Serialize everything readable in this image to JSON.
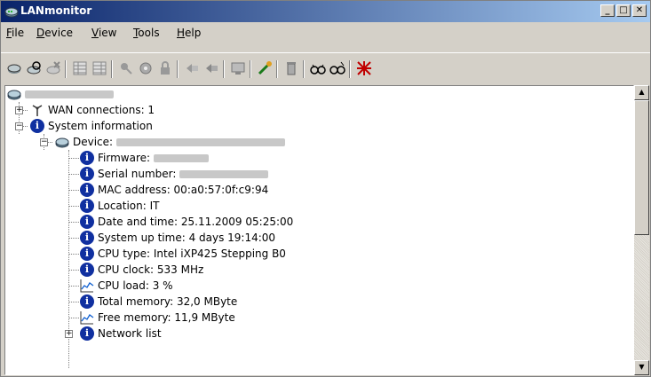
{
  "window": {
    "title": "LANmonitor",
    "controls": {
      "minimize": "_",
      "maximize": "□",
      "close": "✕"
    }
  },
  "menu": [
    {
      "label": "File",
      "u": "F",
      "rest": "ile"
    },
    {
      "label": "Device",
      "u": "D",
      "rest": "evice"
    },
    {
      "label": "View",
      "u": "V",
      "rest": "iew"
    },
    {
      "label": "Tools",
      "u": "T",
      "rest": "ools"
    },
    {
      "label": "Help",
      "u": "H",
      "rest": "elp"
    }
  ],
  "toolbar": {
    "icons": [
      "router-icon",
      "search-device-icon",
      "remove-device-icon",
      "grid-icon",
      "grid-alt-icon",
      "key-icon",
      "config-icon",
      "lock-icon",
      "back-icon",
      "forward-icon",
      "monitor-icon",
      "wand-icon",
      "trash-icon",
      "goggles-icon",
      "goggles-alt-icon",
      "disconnect-icon"
    ]
  },
  "tree": {
    "root_blurred": true,
    "items": [
      {
        "label": "WAN connections: 1"
      },
      {
        "label": "System information"
      },
      {
        "label": "Device:"
      },
      {
        "label": "Firmware:"
      },
      {
        "label": "Serial number:"
      },
      {
        "label": "MAC address: 00:a0:57:0f:c9:94"
      },
      {
        "label": "Location: IT"
      },
      {
        "label": "Date and time: 25.11.2009 05:25:00"
      },
      {
        "label": "System up time: 4 days 19:14:00"
      },
      {
        "label": "CPU type: Intel iXP425 Stepping B0"
      },
      {
        "label": "CPU clock: 533 MHz"
      },
      {
        "label": "CPU load: 3 %"
      },
      {
        "label": "Total memory: 32,0 MByte"
      },
      {
        "label": "Free memory: 11,9 MByte"
      },
      {
        "label": "Network list"
      }
    ],
    "info_glyph": "i",
    "expander_plus": "+",
    "expander_minus": "−"
  },
  "colors": {
    "titlebar": "#0a246a",
    "info_icon": "#1030a0",
    "window": "#d4d0c8"
  }
}
